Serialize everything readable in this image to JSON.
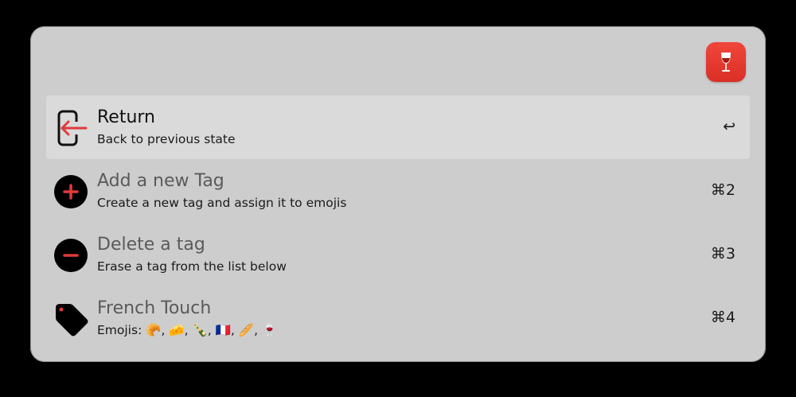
{
  "colors": {
    "accent_red": "#e03a3a",
    "background": "#000000",
    "panel": "#cdcdcd",
    "selected_row": "#dadada"
  },
  "header": {
    "app_icon": "wine-glass-icon"
  },
  "items": [
    {
      "title": "Return",
      "subtitle": "Back to previous state",
      "shortcut": "↩",
      "icon": "return-arrow-icon",
      "selected": true
    },
    {
      "title": "Add a new Tag",
      "subtitle": "Create a new tag and assign it to emojis",
      "shortcut": "⌘2",
      "icon": "plus-circle-icon",
      "selected": false
    },
    {
      "title": "Delete a tag",
      "subtitle": "Erase a tag from the list below",
      "shortcut": "⌘3",
      "icon": "minus-circle-icon",
      "selected": false
    },
    {
      "title": "French Touch",
      "subtitle": "Emojis: 🥐, 🧀, 🍾, 🇫🇷, 🥖, 🍷",
      "shortcut": "⌘4",
      "icon": "tag-icon",
      "selected": false
    }
  ]
}
